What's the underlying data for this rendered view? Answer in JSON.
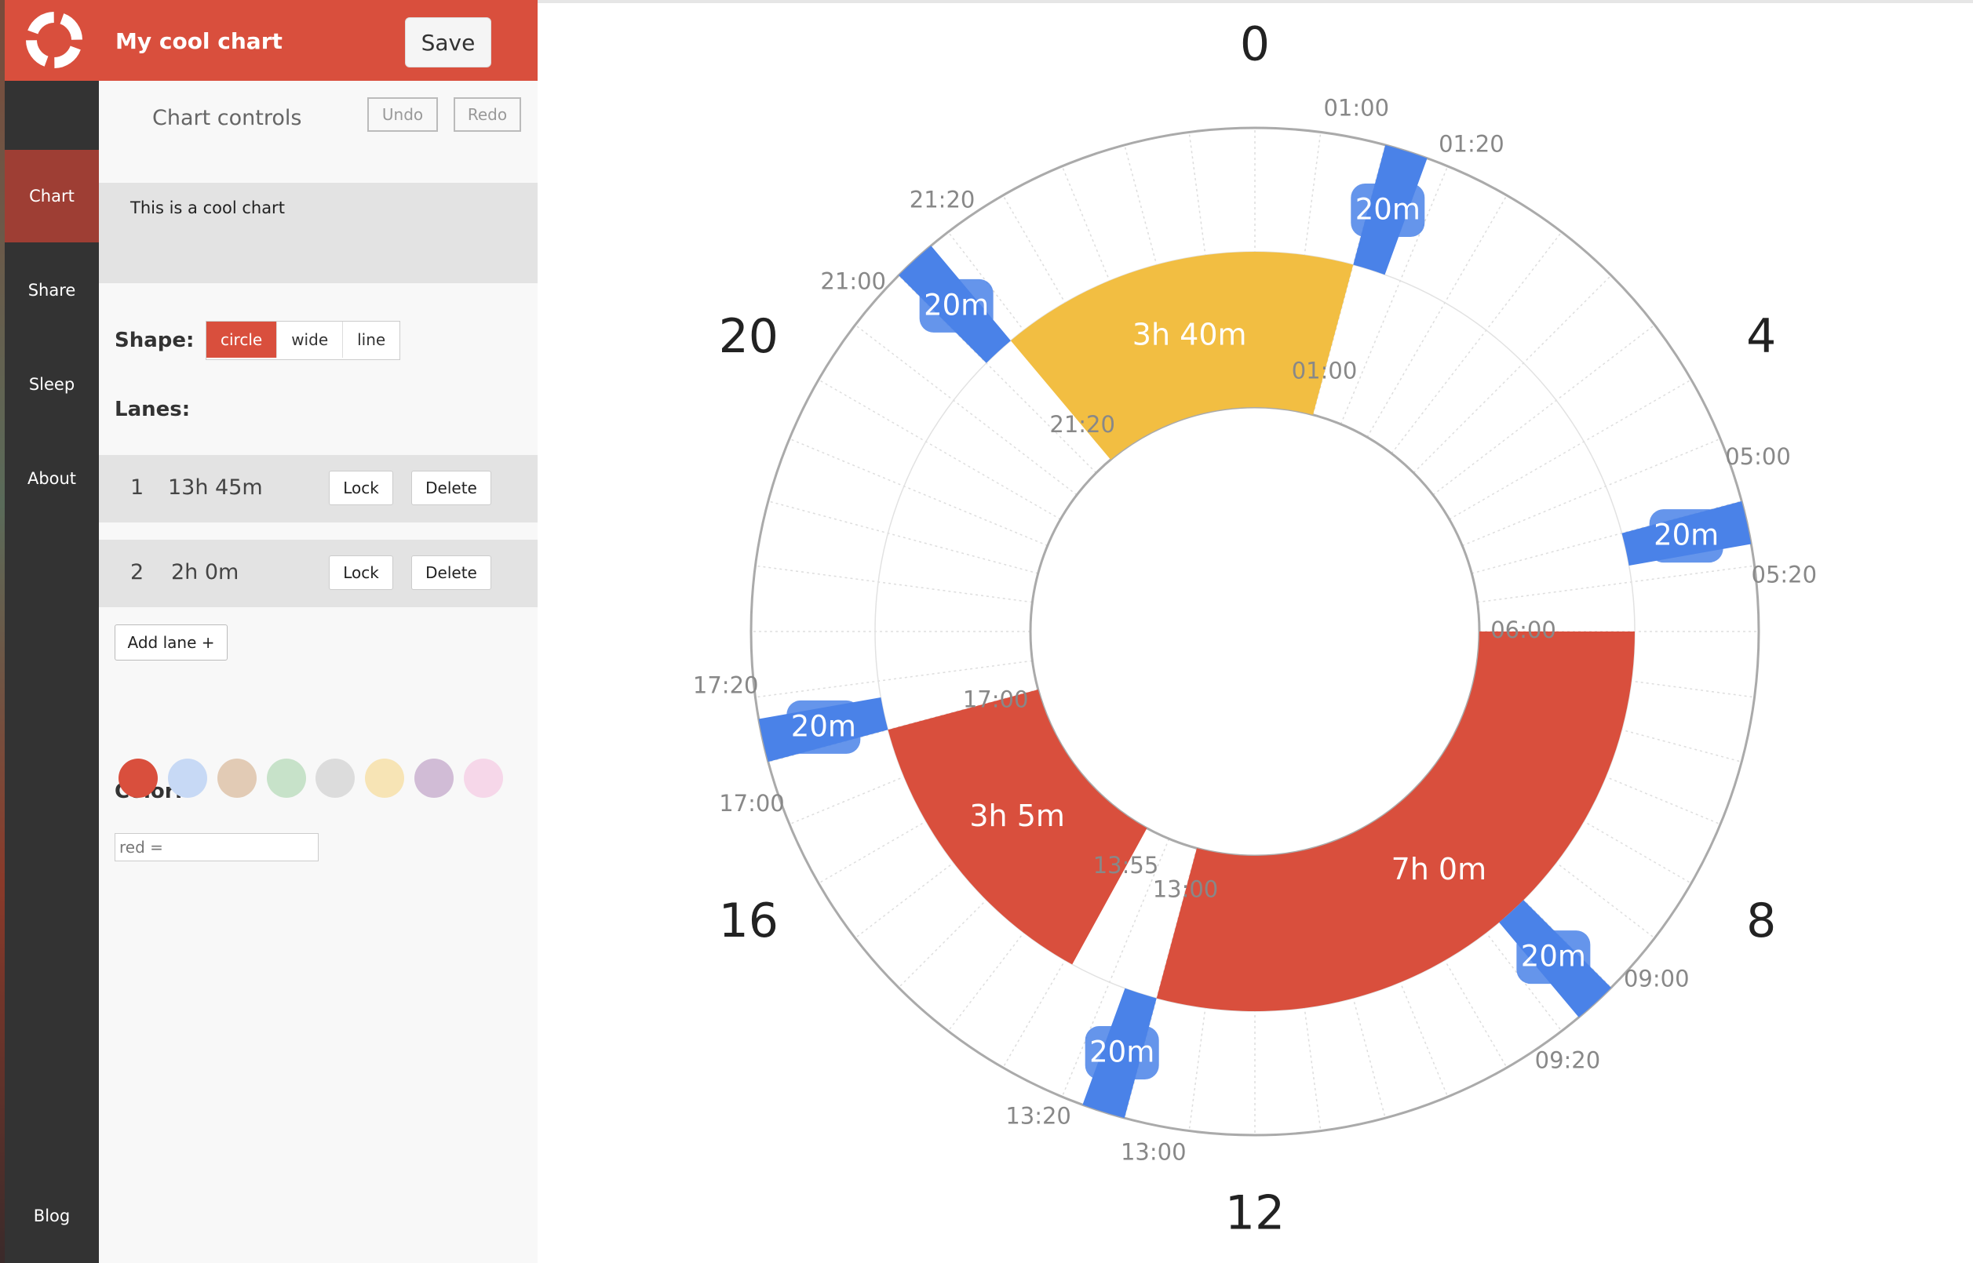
{
  "app": {
    "title": "My cool chart",
    "save_label": "Save"
  },
  "sidebar": {
    "items": [
      {
        "label": "Chart",
        "active": true
      },
      {
        "label": "Share"
      },
      {
        "label": "Sleep"
      },
      {
        "label": "About"
      }
    ],
    "bottom_item": "Blog"
  },
  "controls": {
    "title": "Chart controls",
    "undo_label": "Undo",
    "redo_label": "Redo",
    "description": "This is a cool chart",
    "shape_label": "Shape:",
    "shapes": [
      "circle",
      "wide",
      "line"
    ],
    "active_shape": "circle",
    "lanes_label": "Lanes:",
    "lanes": [
      {
        "number": "1",
        "duration": "13h 45m",
        "lock_label": "Lock",
        "delete_label": "Delete"
      },
      {
        "number": "2",
        "duration": "2h 0m",
        "lock_label": "Lock",
        "delete_label": "Delete"
      }
    ],
    "add_lane_label": "Add lane +",
    "color_label": "Color:",
    "colors": [
      "#d94f3d",
      "#c7d9f5",
      "#e2cbb5",
      "#c7e2c9",
      "#dcdcdc",
      "#f7e4b5",
      "#d1bcd6",
      "#f6d7e9"
    ],
    "color_input_value": "red ="
  },
  "chart_data": {
    "type": "radial-schedule",
    "hours_in_cycle": 24,
    "hour_labels": [
      "0",
      "4",
      "8",
      "12",
      "16",
      "20"
    ],
    "colors": {
      "yellow": "#f2be42",
      "red": "#d94f3d",
      "blue": "#4a82e8"
    },
    "blocks": [
      {
        "start": "21:20",
        "end": "01:00",
        "label": "3h 40m",
        "color": "yellow",
        "lane": 2
      },
      {
        "start": "06:00",
        "end": "13:00",
        "label": "7h 0m",
        "color": "red",
        "lane": 2
      },
      {
        "start": "13:55",
        "end": "17:00",
        "label": "3h 5m",
        "color": "red",
        "lane": 2
      }
    ],
    "naps": [
      {
        "start": "01:00",
        "end": "01:20",
        "label": "20m",
        "color": "blue",
        "lane": 1
      },
      {
        "start": "05:00",
        "end": "05:20",
        "label": "20m",
        "color": "blue",
        "lane": 1
      },
      {
        "start": "09:00",
        "end": "09:20",
        "label": "20m",
        "color": "blue",
        "lane": 1
      },
      {
        "start": "13:00",
        "end": "13:20",
        "label": "20m",
        "color": "blue",
        "lane": 1
      },
      {
        "start": "17:00",
        "end": "17:20",
        "label": "20m",
        "color": "blue",
        "lane": 1
      },
      {
        "start": "21:00",
        "end": "21:20",
        "label": "20m",
        "color": "blue",
        "lane": 1
      }
    ],
    "time_labels": [
      "21:20",
      "01:00",
      "06:00",
      "13:00",
      "13:55",
      "17:00",
      "01:00",
      "01:20",
      "05:00",
      "05:20",
      "09:00",
      "09:20",
      "13:00",
      "13:20",
      "17:00",
      "17:20",
      "21:00",
      "21:20"
    ]
  }
}
